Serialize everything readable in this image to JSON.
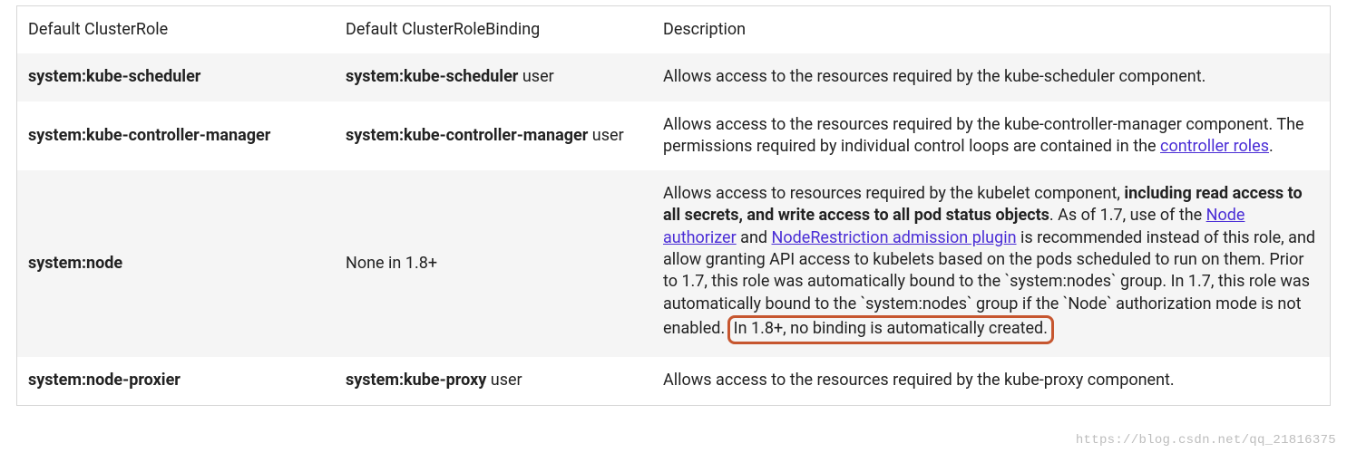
{
  "headers": {
    "col1": "Default ClusterRole",
    "col2": "Default ClusterRoleBinding",
    "col3": "Description"
  },
  "rows": [
    {
      "role": "system:kube-scheduler",
      "binding_bold": "system:kube-scheduler",
      "binding_suffix": " user",
      "desc_plain": "Allows access to the resources required by the kube-scheduler component."
    },
    {
      "role": "system:kube-controller-manager",
      "binding_bold": "system:kube-controller-manager",
      "binding_suffix": " user",
      "desc_prefix": "Allows access to the resources required by the kube-controller-manager component. The permissions required by individual control loops are contained in the ",
      "desc_link1": "controller roles",
      "desc_after_link1": "."
    },
    {
      "role": "system:node",
      "binding_plain": "None in 1.8+",
      "desc_p1": "Allows access to resources required by the kubelet component, ",
      "desc_bold": "including read access to all secrets, and write access to all pod status objects",
      "desc_p2": ". As of 1.7, use of the ",
      "desc_link1": "Node authorizer",
      "desc_p3": " and ",
      "desc_link2": "NodeRestriction admission plugin",
      "desc_p4": " is recommended instead of this role, and allow granting API access to kubelets based on the pods scheduled to run on them. Prior to 1.7, this role was automatically bound to the `system:nodes` group. In 1.7, this role was automatically bound to the `system:nodes` group if the `Node` authorization mode is not enabled. ",
      "desc_highlight": "In 1.8+, no binding is automatically created."
    },
    {
      "role": "system:node-proxier",
      "binding_bold": "system:kube-proxy",
      "binding_suffix": " user",
      "desc_plain": "Allows access to the resources required by the kube-proxy component."
    }
  ],
  "watermark": "https://blog.csdn.net/qq_21816375"
}
